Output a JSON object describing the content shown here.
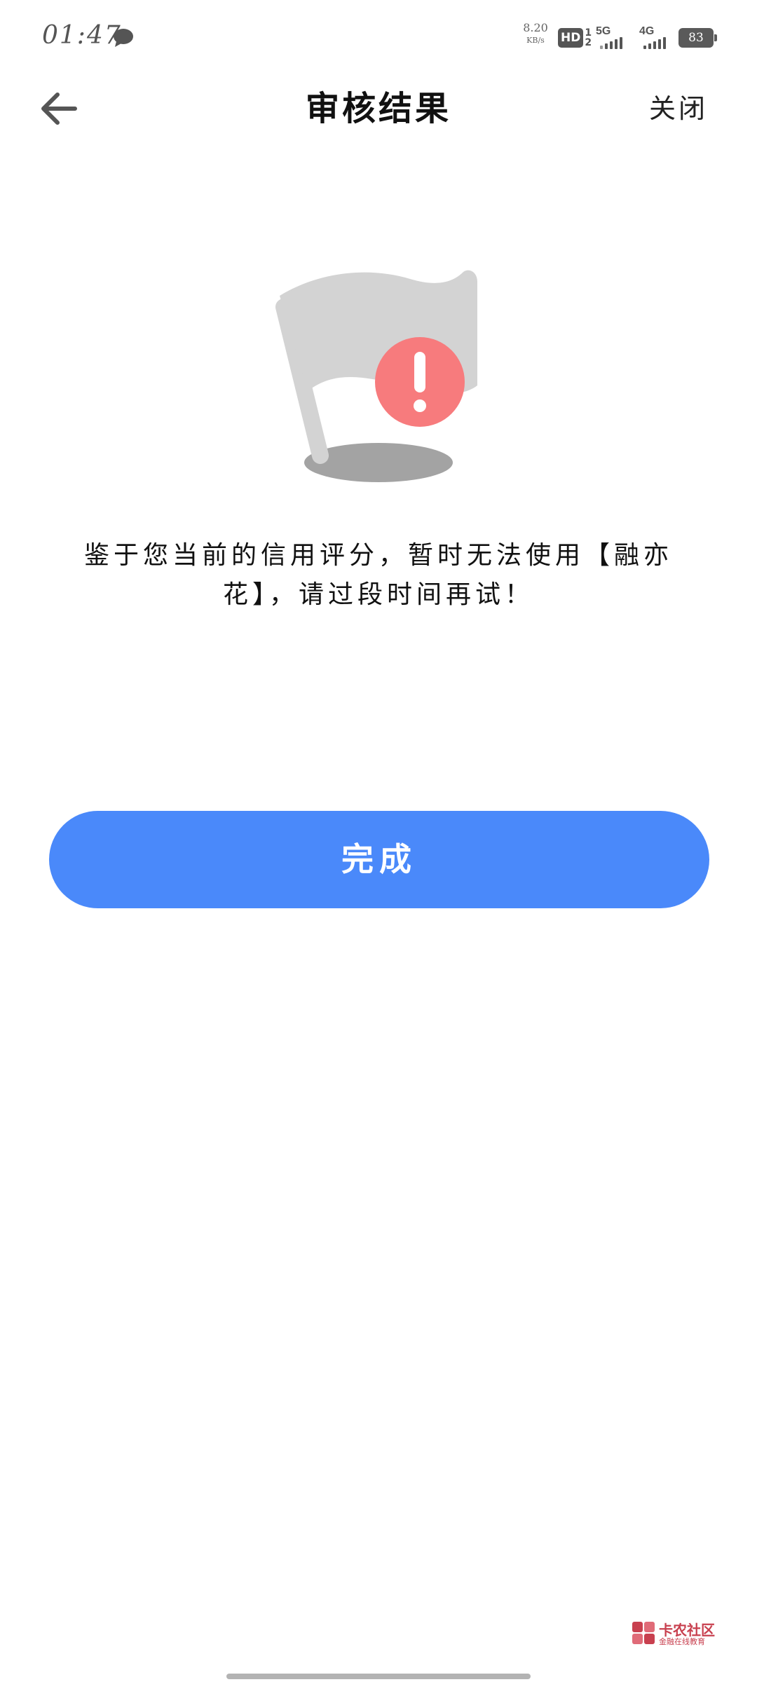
{
  "status_bar": {
    "time": "01:47",
    "net_speed_value": "8.20",
    "net_speed_unit": "KB/s",
    "hd_label": "HD",
    "hd_sub_top": "1",
    "hd_sub_bottom": "2",
    "sim1_label": "5G",
    "sim2_label": "4G",
    "battery": "83",
    "icons": [
      "message-icon",
      "hd-volte-icon",
      "signal-5g-icon",
      "signal-4g-icon",
      "battery-icon"
    ]
  },
  "header": {
    "title": "审核结果",
    "close_label": "关闭",
    "back_icon": "arrow-left-icon"
  },
  "illustration": {
    "icon": "flag-warning-icon",
    "flag_color": "#d3d3d3",
    "shadow_color": "#a3a3a3",
    "alert_color": "#f77b7d"
  },
  "message": {
    "line1": "鉴于您当前的信用评分，暂时无法使用【融亦",
    "line2": "花】，请过段时间再试！"
  },
  "actions": {
    "done_label": "完成",
    "done_color": "#4a89fa"
  },
  "watermark": {
    "title": "卡农社区",
    "subtitle": "金融在线教育"
  }
}
